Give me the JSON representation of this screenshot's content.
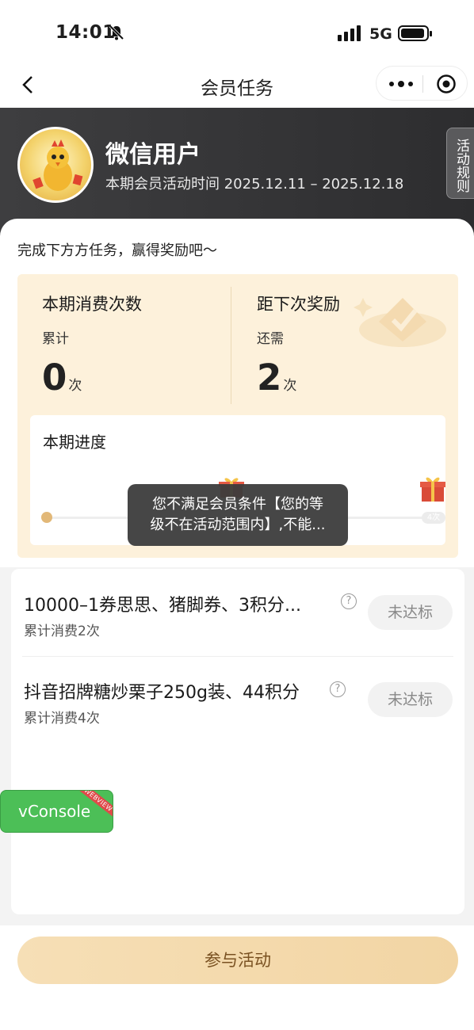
{
  "status_bar": {
    "time": "14:01",
    "network": "5G"
  },
  "nav": {
    "title": "会员任务"
  },
  "profile": {
    "name": "微信用户",
    "period": "本期会员活动时间 2025.12.11 – 2025.12.18",
    "rules_label": "活动规则"
  },
  "tip": "完成下方方任务，赢得奖励吧～",
  "stats": {
    "count_title": "本期消费次数",
    "count_sub": "累计",
    "count_value": "0",
    "count_unit": "次",
    "next_title": "距下次奖励",
    "next_sub": "还需",
    "next_value": "2",
    "next_unit": "次"
  },
  "progress": {
    "title": "本期进度",
    "end_badge": "4次",
    "current": 0,
    "max": 4
  },
  "toast": {
    "line1": "您不满足会员条件【您的等",
    "line2": "级不在活动范围内】,不能..."
  },
  "tasks": [
    {
      "title": "10000–1券思思、猪脚券、3积分...",
      "subtitle": "累计消费2次",
      "status": "未达标"
    },
    {
      "title": "抖音招牌糖炒栗子250g装、44积分",
      "subtitle": "累计消费4次",
      "status": "未达标"
    }
  ],
  "vconsole": {
    "label": "vConsole",
    "ribbon": "WEBVIEW"
  },
  "bottom": {
    "join_label": "参与活动"
  },
  "colors": {
    "accent": "#f2d5a4",
    "header_bg": "#333335",
    "reward_bg": "#fdf1db",
    "vconsole": "#4cbf57"
  }
}
